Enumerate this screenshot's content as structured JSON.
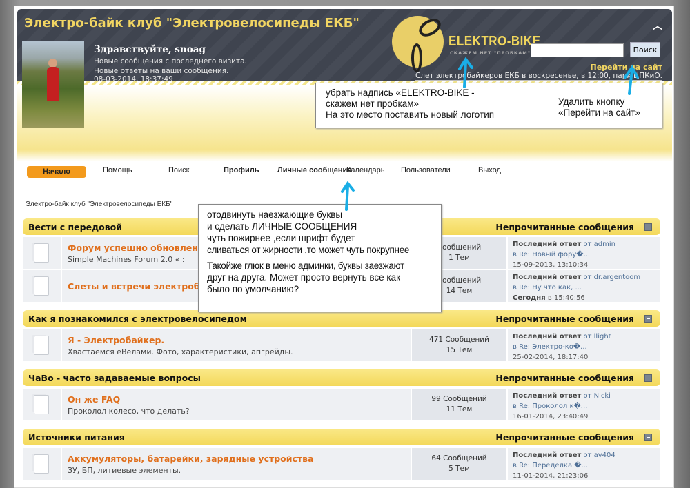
{
  "header": {
    "title": "Электро-байк клуб \"Электровелосипеды ЕКБ\"",
    "greeting": "Здравствуйте, snoag",
    "new_posts": "Новые сообщения с последнего визита.",
    "new_replies": "Новые ответы на ваши сообщения.",
    "datetime": "08-03-2014, 18:37:49",
    "logo_title": "ELEKTRO-BIKE",
    "logo_slogan": "СКАЖЕМ НЕТ \"ПРОБКАМ\"!",
    "search_value": "",
    "search_button": "Поиск",
    "go_site": "Перейти на сайт",
    "news": "Слет электробайкеров ЕКБ в воскресенье, в 12:00, парк ЦПКиО."
  },
  "nav": {
    "home": "Начало",
    "help": "Помощь",
    "search": "Поиск",
    "profile": "Профиль",
    "pm": "Личные сообщения",
    "calendar": "Календарь",
    "members": "Пользователи",
    "logout": "Выход"
  },
  "breadcrumb": "Электро-байк клуб \"Электровелосипеды ЕКБ\"",
  "unread_label": "Непрочитанные сообщения",
  "last_post_label": "Последний ответ",
  "categories": [
    {
      "name": "Вести с передовой",
      "boards": [
        {
          "name": "Форум успешно обновлен",
          "desc": "Simple Machines Forum 2.0 « :",
          "posts": "Сообщений",
          "topics": "1 Тем",
          "last_by": "от admin",
          "last_in": "в Re: Новый фору�...",
          "last_time": "15-09-2013, 13:10:34"
        },
        {
          "name": "Слеты и встречи электробайкеров",
          "desc": "",
          "posts": "Сообщений",
          "topics": "14 Тем",
          "last_by": "от dr.argentoom",
          "last_in": "в Re: Ну что как, ...",
          "last_today": "Сегодня",
          "last_time": "в 15:40:56"
        }
      ]
    },
    {
      "name": "Как я познакомился с электровелосипедом",
      "boards": [
        {
          "name": "Я - Электробайкер.",
          "desc": "Хвастаемся еВелами. Фото, характеристики, апгрейды.",
          "posts": "471 Сообщений",
          "topics": "15 Тем",
          "last_by": "от llight",
          "last_in": "в Re: Электро-ко�...",
          "last_time": "25-02-2014, 18:17:40"
        }
      ]
    },
    {
      "name": "ЧаВо - часто задаваемые вопросы",
      "boards": [
        {
          "name": "Он же FAQ",
          "desc": "Проколол колесо, что делать?",
          "posts": "99 Сообщений",
          "topics": "11 Тем",
          "last_by": "от Nicki",
          "last_in": "в Re: Проколол к�...",
          "last_time": "16-01-2014, 23:40:49"
        }
      ]
    },
    {
      "name": "Источники питания",
      "boards": [
        {
          "name": "Аккумуляторы, батарейки, зарядные устройства",
          "desc": "ЗУ, БП, литиевые элементы.",
          "posts": "64 Сообщений",
          "topics": "5 Тем",
          "last_by": "от av404",
          "last_in": "в Re: Переделка �...",
          "last_time": "11-01-2014, 21:23:06"
        }
      ]
    }
  ],
  "notes": {
    "logo_note": [
      "убрать надпись «ELEKTRO-BIKE -",
      "скажем нет пробкам»",
      "На это место поставить новый логотип"
    ],
    "button_note": [
      "Удалить кнопку",
      "«Перейти на сайт»"
    ],
    "menu_note": [
      "отодвинуть наезжающие буквы",
      "и сделать ЛИЧНЫЕ СООБЩЕНИЯ",
      "чуть пожирнее ,если шрифт будет",
      "сливаться от жирности ,то может чуть покрупнее"
    ],
    "admin_note": [
      "Такойже глюк в меню админки, буквы заезжают",
      "друг на друга. Может просто вернуть все как",
      "было по умолчанию?"
    ]
  },
  "colors": {
    "accent": "#f39a1c",
    "header_bg": "#3f444f",
    "title": "#f1d562",
    "board_link": "#e06f1c",
    "annotation_arrow": "#1aaee6"
  }
}
